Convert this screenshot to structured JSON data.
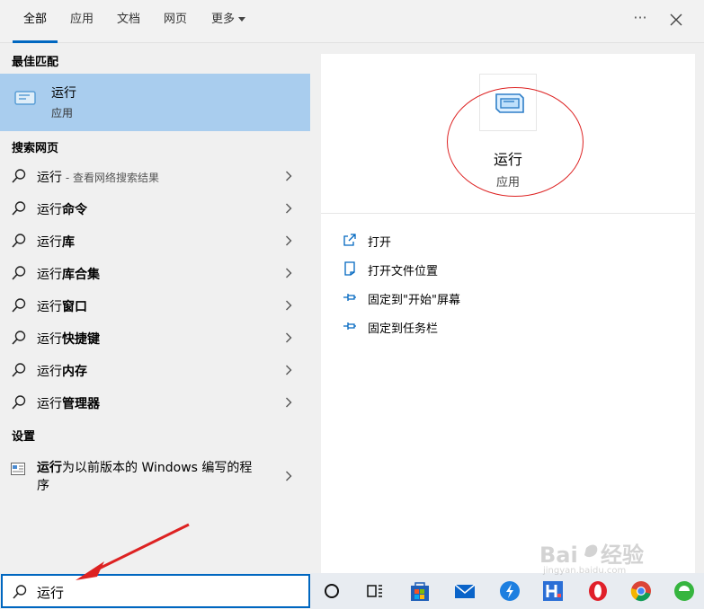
{
  "tabs": [
    {
      "label": "全部",
      "active": true
    },
    {
      "label": "应用",
      "active": false
    },
    {
      "label": "文档",
      "active": false
    },
    {
      "label": "网页",
      "active": false
    },
    {
      "label": "更多",
      "active": false
    }
  ],
  "header": {
    "more_label": "···"
  },
  "best_match": {
    "section_title": "最佳匹配",
    "title": "运行",
    "subtitle": "应用"
  },
  "web_search": {
    "section_title": "搜索网页",
    "items": [
      {
        "prefix": "运行",
        "suffix": "",
        "hint": " - 查看网络搜索结果"
      },
      {
        "prefix": "运行",
        "suffix": "命令",
        "hint": ""
      },
      {
        "prefix": "运行",
        "suffix": "库",
        "hint": ""
      },
      {
        "prefix": "运行",
        "suffix": "库合集",
        "hint": ""
      },
      {
        "prefix": "运行",
        "suffix": "窗口",
        "hint": ""
      },
      {
        "prefix": "运行",
        "suffix": "快捷键",
        "hint": ""
      },
      {
        "prefix": "运行",
        "suffix": "内存",
        "hint": ""
      },
      {
        "prefix": "运行",
        "suffix": "管理器",
        "hint": ""
      }
    ]
  },
  "settings": {
    "section_title": "设置",
    "item_bold": "运行",
    "item_rest": "为以前版本的 Windows 编写的程序"
  },
  "detail": {
    "title": "运行",
    "subtitle": "应用",
    "actions": [
      {
        "label": "打开",
        "icon": "open-icon"
      },
      {
        "label": "打开文件位置",
        "icon": "file-location-icon"
      },
      {
        "label": "固定到\"开始\"屏幕",
        "icon": "pin-icon"
      },
      {
        "label": "固定到任务栏",
        "icon": "pin-icon"
      }
    ]
  },
  "search": {
    "value": "运行"
  },
  "colors": {
    "accent": "#0067c0",
    "selection": "#a9cdee",
    "annotation": "#dd2222"
  },
  "taskbar_icons": [
    "cortana-circle-icon",
    "task-view-icon",
    "store-icon",
    "mail-icon",
    "thunder-icon",
    "h-app-icon",
    "opera-icon",
    "chrome-icon",
    "green-browser-icon"
  ],
  "watermark": {
    "text": "Bai du 经验",
    "sub": "jingyan.baidu.com"
  }
}
